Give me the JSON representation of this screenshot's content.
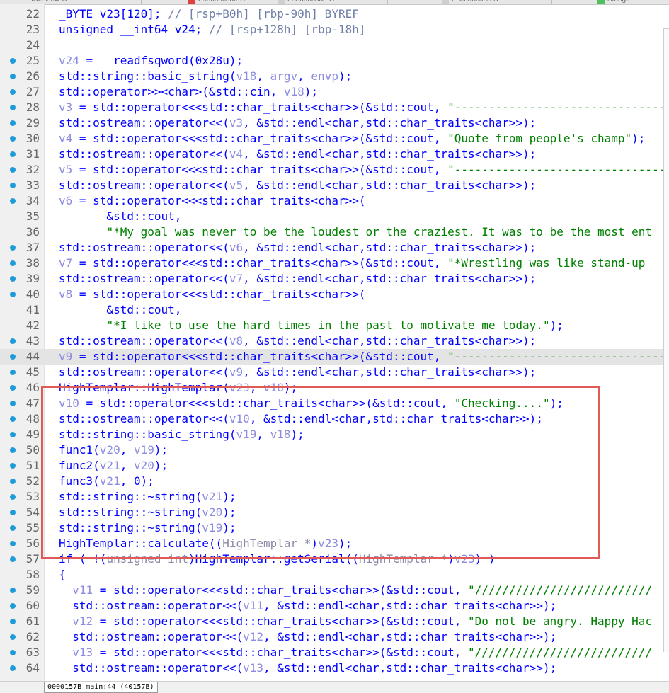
{
  "tabs": [
    {
      "label": "IDA View-A",
      "swatch": ""
    },
    {
      "label": "Pseudocode-C",
      "swatch": "#e04040"
    },
    {
      "label": "Pseudocode-C",
      "swatch": "#cfcfcf"
    },
    {
      "label": "Pseudocode-B",
      "swatch": "#cfcfcf"
    },
    {
      "label": "Strings",
      "swatch": "#50c060"
    }
  ],
  "colors": {
    "breakpoint_dot": "#1e9bd8",
    "highlight_box": "#e05a5a",
    "keyword": "#0000ff",
    "string": "#008000",
    "comment": "#6f7fa8",
    "variable": "#8c8ce0"
  },
  "lines": [
    {
      "n": "22",
      "dot": false,
      "hl": false,
      "code": [
        {
          "t": "_BYTE v23[120]; ",
          "c": ""
        },
        {
          "t": "// [rsp+B0h] [rbp-90h] BYREF",
          "c": "cm"
        }
      ]
    },
    {
      "n": "23",
      "dot": false,
      "hl": false,
      "code": [
        {
          "t": "unsigned __int64 v24; ",
          "c": ""
        },
        {
          "t": "// [rsp+128h] [rbp-18h]",
          "c": "cm"
        }
      ]
    },
    {
      "n": "24",
      "dot": false,
      "hl": false,
      "code": []
    },
    {
      "n": "25",
      "dot": true,
      "hl": false,
      "code": [
        {
          "t": "v24",
          "c": "vr"
        },
        {
          "t": " = __readfsqword(0x28u);",
          "c": ""
        }
      ]
    },
    {
      "n": "26",
      "dot": true,
      "hl": false,
      "code": [
        {
          "t": "std::string::basic_string(",
          "c": ""
        },
        {
          "t": "v18",
          "c": "vr"
        },
        {
          "t": ", ",
          "c": ""
        },
        {
          "t": "argv",
          "c": "vr"
        },
        {
          "t": ", ",
          "c": ""
        },
        {
          "t": "envp",
          "c": "vr"
        },
        {
          "t": ");",
          "c": ""
        }
      ]
    },
    {
      "n": "27",
      "dot": true,
      "hl": false,
      "code": [
        {
          "t": "std::operator>><char>(&std::cin, ",
          "c": ""
        },
        {
          "t": "v18",
          "c": "vr"
        },
        {
          "t": ");",
          "c": ""
        }
      ]
    },
    {
      "n": "28",
      "dot": true,
      "hl": false,
      "code": [
        {
          "t": "v3",
          "c": "vr"
        },
        {
          "t": " = std::operator<<<std::char_traits<char>>(&std::cout, ",
          "c": ""
        },
        {
          "t": "\"----------------------------------------",
          "c": "st"
        }
      ]
    },
    {
      "n": "29",
      "dot": true,
      "hl": false,
      "code": [
        {
          "t": "std::ostream::operator<<(",
          "c": ""
        },
        {
          "t": "v3",
          "c": "vr"
        },
        {
          "t": ", &std::endl<char,std::char_traits<char>>);",
          "c": ""
        }
      ]
    },
    {
      "n": "30",
      "dot": true,
      "hl": false,
      "code": [
        {
          "t": "v4",
          "c": "vr"
        },
        {
          "t": " = std::operator<<<std::char_traits<char>>(&std::cout, ",
          "c": ""
        },
        {
          "t": "\"Quote from people's champ\"",
          "c": "st"
        },
        {
          "t": ");",
          "c": ""
        }
      ]
    },
    {
      "n": "31",
      "dot": true,
      "hl": false,
      "code": [
        {
          "t": "std::ostream::operator<<(",
          "c": ""
        },
        {
          "t": "v4",
          "c": "vr"
        },
        {
          "t": ", &std::endl<char,std::char_traits<char>>);",
          "c": ""
        }
      ]
    },
    {
      "n": "32",
      "dot": true,
      "hl": false,
      "code": [
        {
          "t": "v5",
          "c": "vr"
        },
        {
          "t": " = std::operator<<<std::char_traits<char>>(&std::cout, ",
          "c": ""
        },
        {
          "t": "\"----------------------------------------",
          "c": "st"
        }
      ]
    },
    {
      "n": "33",
      "dot": true,
      "hl": false,
      "code": [
        {
          "t": "std::ostream::operator<<(",
          "c": ""
        },
        {
          "t": "v5",
          "c": "vr"
        },
        {
          "t": ", &std::endl<char,std::char_traits<char>>);",
          "c": ""
        }
      ]
    },
    {
      "n": "34",
      "dot": true,
      "hl": false,
      "code": [
        {
          "t": "v6",
          "c": "vr"
        },
        {
          "t": " = std::operator<<<std::char_traits<char>>(",
          "c": ""
        }
      ]
    },
    {
      "n": "35",
      "dot": false,
      "hl": false,
      "code": [
        {
          "t": "       &std::cout,",
          "c": ""
        }
      ]
    },
    {
      "n": "36",
      "dot": false,
      "hl": false,
      "code": [
        {
          "t": "       ",
          "c": ""
        },
        {
          "t": "\"*My goal was never to be the loudest or the craziest. It was to be the most ent",
          "c": "st"
        }
      ]
    },
    {
      "n": "37",
      "dot": true,
      "hl": false,
      "code": [
        {
          "t": "std::ostream::operator<<(",
          "c": ""
        },
        {
          "t": "v6",
          "c": "vr"
        },
        {
          "t": ", &std::endl<char,std::char_traits<char>>);",
          "c": ""
        }
      ]
    },
    {
      "n": "38",
      "dot": true,
      "hl": false,
      "code": [
        {
          "t": "v7",
          "c": "vr"
        },
        {
          "t": " = std::operator<<<std::char_traits<char>>(&std::cout, ",
          "c": ""
        },
        {
          "t": "\"*Wrestling was like stand-up",
          "c": "st"
        }
      ]
    },
    {
      "n": "39",
      "dot": true,
      "hl": false,
      "code": [
        {
          "t": "std::ostream::operator<<(",
          "c": ""
        },
        {
          "t": "v7",
          "c": "vr"
        },
        {
          "t": ", &std::endl<char,std::char_traits<char>>);",
          "c": ""
        }
      ]
    },
    {
      "n": "40",
      "dot": true,
      "hl": false,
      "code": [
        {
          "t": "v8",
          "c": "vr"
        },
        {
          "t": " = std::operator<<<std::char_traits<char>>(",
          "c": ""
        }
      ]
    },
    {
      "n": "41",
      "dot": false,
      "hl": false,
      "code": [
        {
          "t": "       &std::cout,",
          "c": ""
        }
      ]
    },
    {
      "n": "42",
      "dot": false,
      "hl": false,
      "code": [
        {
          "t": "       ",
          "c": ""
        },
        {
          "t": "\"*I like to use the hard times in the past to motivate me today.\"",
          "c": "st"
        },
        {
          "t": ");",
          "c": ""
        }
      ]
    },
    {
      "n": "43",
      "dot": true,
      "hl": false,
      "code": [
        {
          "t": "std::ostream::operator<<(",
          "c": ""
        },
        {
          "t": "v8",
          "c": "vr"
        },
        {
          "t": ", &std::endl<char,std::char_traits<char>>);",
          "c": ""
        }
      ]
    },
    {
      "n": "44",
      "dot": true,
      "hl": true,
      "code": [
        {
          "t": "v9",
          "c": "vr"
        },
        {
          "t": " = std::operator<<<std::char_traits<char>>(&std::cout, ",
          "c": ""
        },
        {
          "t": "\"----------------------------------------",
          "c": "st"
        }
      ]
    },
    {
      "n": "45",
      "dot": true,
      "hl": false,
      "code": [
        {
          "t": "std::ostream::operator<<(",
          "c": ""
        },
        {
          "t": "v9",
          "c": "vr"
        },
        {
          "t": ", &std::endl<char,std::char_traits<char>>);",
          "c": ""
        }
      ]
    },
    {
      "n": "46",
      "dot": true,
      "hl": false,
      "code": [
        {
          "t": "HighTemplar::HighTemplar(",
          "c": ""
        },
        {
          "t": "v23",
          "c": "vr"
        },
        {
          "t": ", ",
          "c": ""
        },
        {
          "t": "v18",
          "c": "vr"
        },
        {
          "t": ");",
          "c": ""
        }
      ]
    },
    {
      "n": "47",
      "dot": true,
      "hl": false,
      "code": [
        {
          "t": "v10",
          "c": "vr"
        },
        {
          "t": " = std::operator<<<std::char_traits<char>>(&std::cout, ",
          "c": ""
        },
        {
          "t": "\"Checking....\"",
          "c": "st"
        },
        {
          "t": ");",
          "c": ""
        }
      ]
    },
    {
      "n": "48",
      "dot": true,
      "hl": false,
      "code": [
        {
          "t": "std::ostream::operator<<(",
          "c": ""
        },
        {
          "t": "v10",
          "c": "vr"
        },
        {
          "t": ", &std::endl<char,std::char_traits<char>>);",
          "c": ""
        }
      ]
    },
    {
      "n": "49",
      "dot": true,
      "hl": false,
      "code": [
        {
          "t": "std::string::basic_string(",
          "c": ""
        },
        {
          "t": "v19",
          "c": "vr"
        },
        {
          "t": ", ",
          "c": ""
        },
        {
          "t": "v18",
          "c": "vr"
        },
        {
          "t": ");",
          "c": ""
        }
      ]
    },
    {
      "n": "50",
      "dot": true,
      "hl": false,
      "code": [
        {
          "t": "func1(",
          "c": ""
        },
        {
          "t": "v20",
          "c": "vr"
        },
        {
          "t": ", ",
          "c": ""
        },
        {
          "t": "v19",
          "c": "vr"
        },
        {
          "t": ");",
          "c": ""
        }
      ]
    },
    {
      "n": "51",
      "dot": true,
      "hl": false,
      "code": [
        {
          "t": "func2(",
          "c": ""
        },
        {
          "t": "v21",
          "c": "vr"
        },
        {
          "t": ", ",
          "c": ""
        },
        {
          "t": "v20",
          "c": "vr"
        },
        {
          "t": ");",
          "c": ""
        }
      ]
    },
    {
      "n": "52",
      "dot": true,
      "hl": false,
      "code": [
        {
          "t": "func3(",
          "c": ""
        },
        {
          "t": "v21",
          "c": "vr"
        },
        {
          "t": ", 0);",
          "c": ""
        }
      ]
    },
    {
      "n": "53",
      "dot": true,
      "hl": false,
      "code": [
        {
          "t": "std::string::~string(",
          "c": ""
        },
        {
          "t": "v21",
          "c": "vr"
        },
        {
          "t": ");",
          "c": ""
        }
      ]
    },
    {
      "n": "54",
      "dot": true,
      "hl": false,
      "code": [
        {
          "t": "std::string::~string(",
          "c": ""
        },
        {
          "t": "v20",
          "c": "vr"
        },
        {
          "t": ");",
          "c": ""
        }
      ]
    },
    {
      "n": "55",
      "dot": true,
      "hl": false,
      "code": [
        {
          "t": "std::string::~string(",
          "c": ""
        },
        {
          "t": "v19",
          "c": "vr"
        },
        {
          "t": ");",
          "c": ""
        }
      ]
    },
    {
      "n": "56",
      "dot": true,
      "hl": false,
      "code": [
        {
          "t": "HighTemplar::calculate((",
          "c": ""
        },
        {
          "t": "HighTemplar *",
          "c": "ty"
        },
        {
          "t": ")",
          "c": ""
        },
        {
          "t": "v23",
          "c": "vr"
        },
        {
          "t": ");",
          "c": ""
        }
      ]
    },
    {
      "n": "57",
      "dot": true,
      "hl": false,
      "code": [
        {
          "t": "if ( !(",
          "c": ""
        },
        {
          "t": "unsigned int",
          "c": "ty"
        },
        {
          "t": ")HighTemplar::getSerial((",
          "c": ""
        },
        {
          "t": "HighTemplar *",
          "c": "ty"
        },
        {
          "t": ")",
          "c": ""
        },
        {
          "t": "v23",
          "c": "vr"
        },
        {
          "t": ") )",
          "c": ""
        }
      ]
    },
    {
      "n": "58",
      "dot": false,
      "hl": false,
      "code": [
        {
          "t": "{",
          "c": ""
        }
      ]
    },
    {
      "n": "59",
      "dot": true,
      "hl": false,
      "code": [
        {
          "t": "  ",
          "c": ""
        },
        {
          "t": "v11",
          "c": "vr"
        },
        {
          "t": " = std::operator<<<std::char_traits<char>>(&std::cout, ",
          "c": ""
        },
        {
          "t": "\"//////////////////////////",
          "c": "st"
        }
      ]
    },
    {
      "n": "60",
      "dot": true,
      "hl": false,
      "code": [
        {
          "t": "  std::ostream::operator<<(",
          "c": ""
        },
        {
          "t": "v11",
          "c": "vr"
        },
        {
          "t": ", &std::endl<char,std::char_traits<char>>);",
          "c": ""
        }
      ]
    },
    {
      "n": "61",
      "dot": true,
      "hl": false,
      "code": [
        {
          "t": "  ",
          "c": ""
        },
        {
          "t": "v12",
          "c": "vr"
        },
        {
          "t": " = std::operator<<<std::char_traits<char>>(&std::cout, ",
          "c": ""
        },
        {
          "t": "\"Do not be angry. Happy Hac",
          "c": "st"
        }
      ]
    },
    {
      "n": "62",
      "dot": true,
      "hl": false,
      "code": [
        {
          "t": "  std::ostream::operator<<(",
          "c": ""
        },
        {
          "t": "v12",
          "c": "vr"
        },
        {
          "t": ", &std::endl<char,std::char_traits<char>>);",
          "c": ""
        }
      ]
    },
    {
      "n": "63",
      "dot": true,
      "hl": false,
      "code": [
        {
          "t": "  ",
          "c": ""
        },
        {
          "t": "v13",
          "c": "vr"
        },
        {
          "t": " = std::operator<<<std::char_traits<char>>(&std::cout, ",
          "c": ""
        },
        {
          "t": "\"//////////////////////////",
          "c": "st"
        }
      ]
    },
    {
      "n": "64",
      "dot": true,
      "hl": false,
      "code": [
        {
          "t": "  std::ostream::operator<<(",
          "c": ""
        },
        {
          "t": "v13",
          "c": "vr"
        },
        {
          "t": ", &std::endl<char,std::char_traits<char>>);",
          "c": ""
        }
      ]
    }
  ],
  "status": {
    "text": "0000157B main:44 (40157B)"
  }
}
